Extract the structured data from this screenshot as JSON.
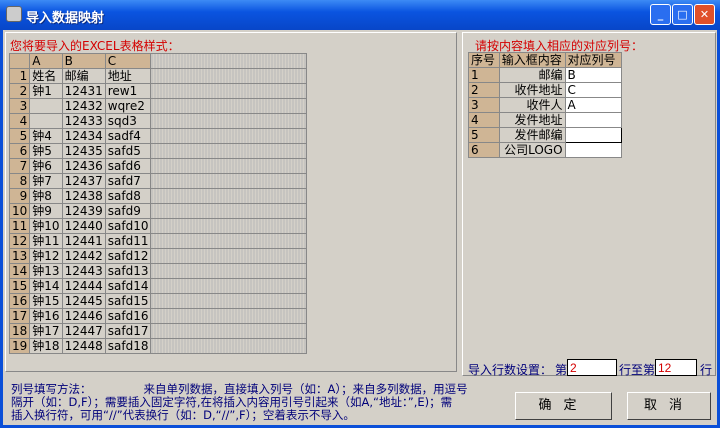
{
  "window": {
    "title": "导入数据映射",
    "icon": "app-icon"
  },
  "left": {
    "label": "您将要导入的EXCEL表格样式：",
    "columns": [
      "A",
      "B",
      "C"
    ],
    "rows": [
      [
        "1",
        "姓名",
        "邮编",
        "地址"
      ],
      [
        "2",
        "钟1",
        "12431",
        "rew1"
      ],
      [
        "3",
        "",
        "12432",
        "wqre2"
      ],
      [
        "4",
        "",
        "12433",
        "sqd3"
      ],
      [
        "5",
        "钟4",
        "12434",
        "sadf4"
      ],
      [
        "6",
        "钟5",
        "12435",
        "safd5"
      ],
      [
        "7",
        "钟6",
        "12436",
        "safd6"
      ],
      [
        "8",
        "钟7",
        "12437",
        "safd7"
      ],
      [
        "9",
        "钟8",
        "12438",
        "safd8"
      ],
      [
        "10",
        "钟9",
        "12439",
        "safd9"
      ],
      [
        "11",
        "钟10",
        "12440",
        "safd10"
      ],
      [
        "12",
        "钟11",
        "12441",
        "safd11"
      ],
      [
        "13",
        "钟12",
        "12442",
        "safd12"
      ],
      [
        "14",
        "钟13",
        "12443",
        "safd13"
      ],
      [
        "15",
        "钟14",
        "12444",
        "safd14"
      ],
      [
        "16",
        "钟15",
        "12445",
        "safd15"
      ],
      [
        "17",
        "钟16",
        "12446",
        "safd16"
      ],
      [
        "18",
        "钟17",
        "12447",
        "safd17"
      ],
      [
        "19",
        "钟18",
        "12448",
        "safd18"
      ]
    ]
  },
  "right": {
    "label": "请按内容填入相应的对应列号：",
    "headers": [
      "序号",
      "输入框内容",
      "对应列号"
    ],
    "rows": [
      [
        "1",
        "邮编",
        "B"
      ],
      [
        "2",
        "收件地址",
        "C"
      ],
      [
        "3",
        "收件人",
        "A"
      ],
      [
        "4",
        "发件地址",
        ""
      ],
      [
        "5",
        "发件邮编",
        ""
      ],
      [
        "6",
        "公司LOGO",
        ""
      ]
    ]
  },
  "rowsetting": {
    "label": "导入行数设置：",
    "from_prefix": "第",
    "from": "2",
    "to_prefix": "行至第",
    "to": "12",
    "suffix": "行"
  },
  "help": {
    "title": "列号填写方法：",
    "line1": "来自单列数据，直接填入列号（如：A）；来自多列数据，用逗号",
    "line2": "隔开（如：D,F）；需要插入固定字符,在将插入内容用引号引起来（如A,“地址：”,E)；需",
    "line3": "插入换行符，可用“//”代表换行（如：D,“//”,F）；空着表示不导入。"
  },
  "buttons": {
    "ok": "确定",
    "cancel": "取消"
  }
}
